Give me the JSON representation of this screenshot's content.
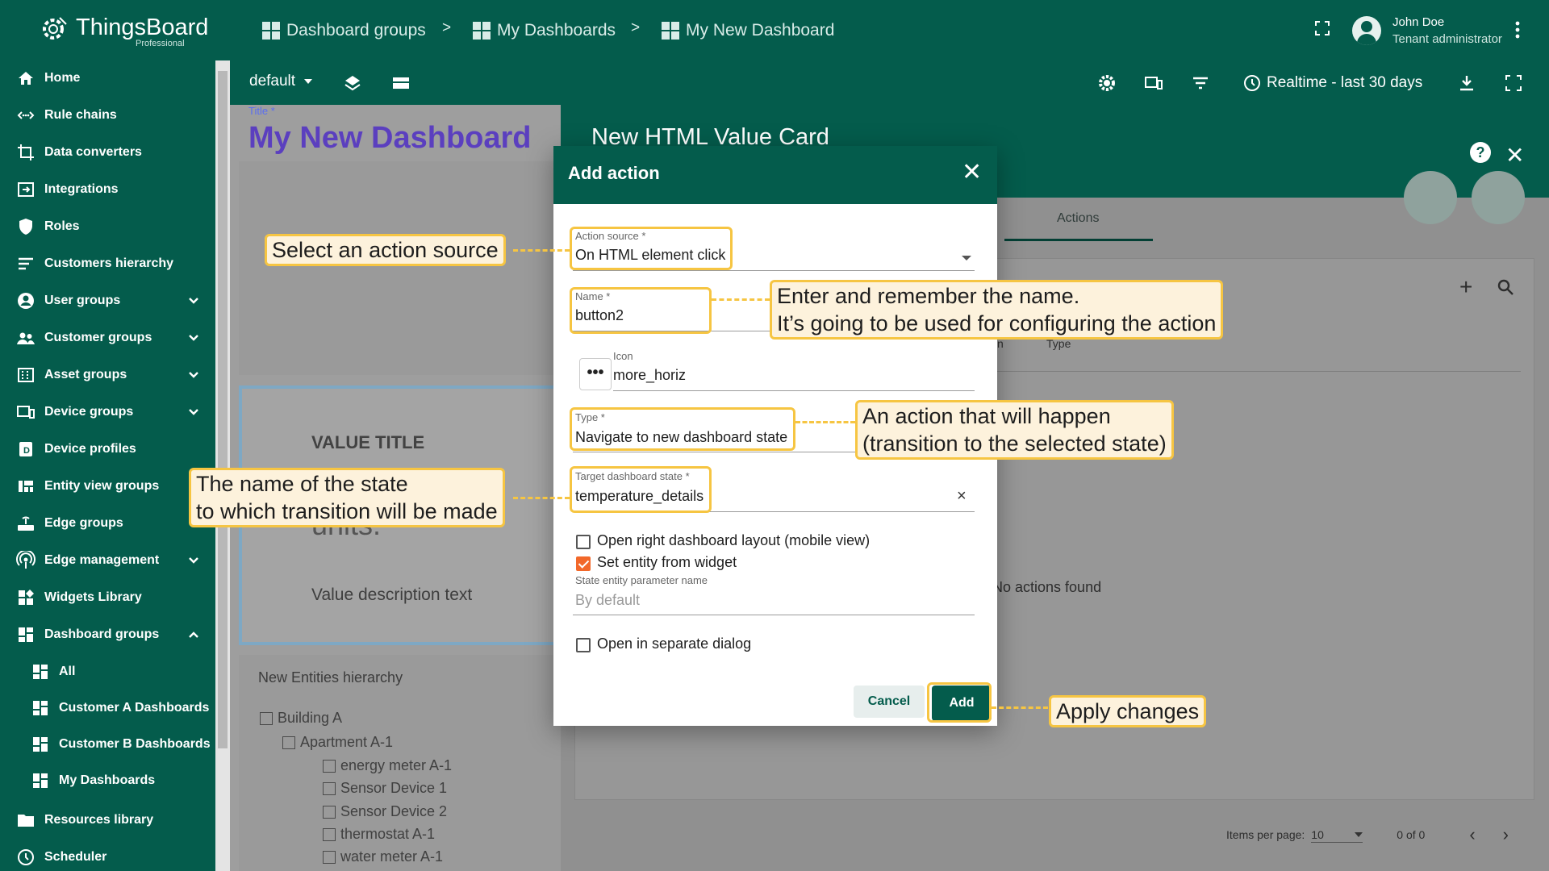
{
  "brand": {
    "name": "ThingsBoard",
    "edition": "Professional"
  },
  "breadcrumb": {
    "items": [
      "Dashboard groups",
      "My Dashboards",
      "My New Dashboard"
    ],
    "separator": ">"
  },
  "user": {
    "name": "John Doe",
    "role": "Tenant administrator"
  },
  "sidebar": {
    "items": [
      {
        "label": "Home",
        "icon": "home-icon"
      },
      {
        "label": "Rule chains",
        "icon": "rule-chain-icon"
      },
      {
        "label": "Data converters",
        "icon": "converter-icon"
      },
      {
        "label": "Integrations",
        "icon": "integration-icon"
      },
      {
        "label": "Roles",
        "icon": "shield-icon"
      },
      {
        "label": "Customers hierarchy",
        "icon": "hierarchy-icon"
      },
      {
        "label": "User groups",
        "icon": "account-icon",
        "expandable": true
      },
      {
        "label": "Customer groups",
        "icon": "people-icon",
        "expandable": true
      },
      {
        "label": "Asset groups",
        "icon": "domain-icon",
        "expandable": true
      },
      {
        "label": "Device groups",
        "icon": "devices-icon",
        "expandable": true
      },
      {
        "label": "Device profiles",
        "icon": "device-profile-icon"
      },
      {
        "label": "Entity view groups",
        "icon": "view-quilt-icon"
      },
      {
        "label": "Edge groups",
        "icon": "router-icon",
        "expandable": true
      },
      {
        "label": "Edge management",
        "icon": "wifi-tethering-icon",
        "expandable": true
      },
      {
        "label": "Widgets Library",
        "icon": "widgets-icon"
      },
      {
        "label": "Dashboard groups",
        "icon": "dashboard-icon",
        "expanded": true
      },
      {
        "label": "All",
        "icon": "dashboard-icon",
        "sub": true
      },
      {
        "label": "Customer A Dashboards",
        "icon": "dashboard-icon",
        "sub": true
      },
      {
        "label": "Customer B Dashboards",
        "icon": "dashboard-icon",
        "sub": true
      },
      {
        "label": "My Dashboards",
        "icon": "dashboard-icon",
        "sub": true
      },
      {
        "label": "Resources library",
        "icon": "folder-icon"
      },
      {
        "label": "Scheduler",
        "icon": "schedule-icon"
      }
    ]
  },
  "toolbar": {
    "state": "default",
    "timewindow": "Realtime - last 30 days"
  },
  "dashboard": {
    "title_label": "Title *",
    "title": "My New Dashboard",
    "value_card": {
      "title": "VALUE TITLE",
      "units": "units.",
      "description": "Value description text"
    },
    "hierarchy": {
      "title": "New Entities hierarchy",
      "nodes": [
        "Building A",
        "Apartment A-1",
        "energy meter A-1",
        "Sensor Device 1",
        "Sensor Device 2",
        "thermostat A-1",
        "water meter A-1"
      ]
    }
  },
  "editor": {
    "title": "New HTML Value Card",
    "tab": "Actions",
    "columns": [
      "n",
      "Type"
    ],
    "empty": "No actions found",
    "pager": {
      "label": "Items per page:",
      "size": "10",
      "range": "0 of 0"
    }
  },
  "dialog": {
    "title": "Add action",
    "action_source": {
      "label": "Action source *",
      "value": "On HTML element click"
    },
    "name": {
      "label": "Name *",
      "value": "button2"
    },
    "icon": {
      "label": "Icon",
      "value": "more_horiz"
    },
    "type": {
      "label": "Type *",
      "value": "Navigate to new dashboard state"
    },
    "target_state": {
      "label": "Target dashboard state *",
      "value": "temperature_details"
    },
    "open_right_layout": {
      "label": "Open right dashboard layout (mobile view)",
      "checked": false
    },
    "set_entity": {
      "label": "Set entity from widget",
      "checked": true
    },
    "state_entity_param": {
      "label": "State entity parameter name",
      "placeholder": "By default"
    },
    "separate_dialog": {
      "label": "Open in separate dialog",
      "checked": false
    },
    "cancel": "Cancel",
    "add": "Add"
  },
  "callouts": {
    "action_source": "Select an action source",
    "name_line1": "Enter and remember the name.",
    "name_line2": "It’s going to be used for configuring the action",
    "type_line1": "An action that will happen",
    "type_line2": "(transition to the selected state)",
    "state_line1": "The name of the state",
    "state_line2": "to which transition will be made",
    "apply": "Apply changes"
  },
  "colors": {
    "primary": "#045c4c",
    "accent": "#f2682a",
    "highlight": "#f6c542",
    "callout_bg": "#fdf2dc"
  }
}
